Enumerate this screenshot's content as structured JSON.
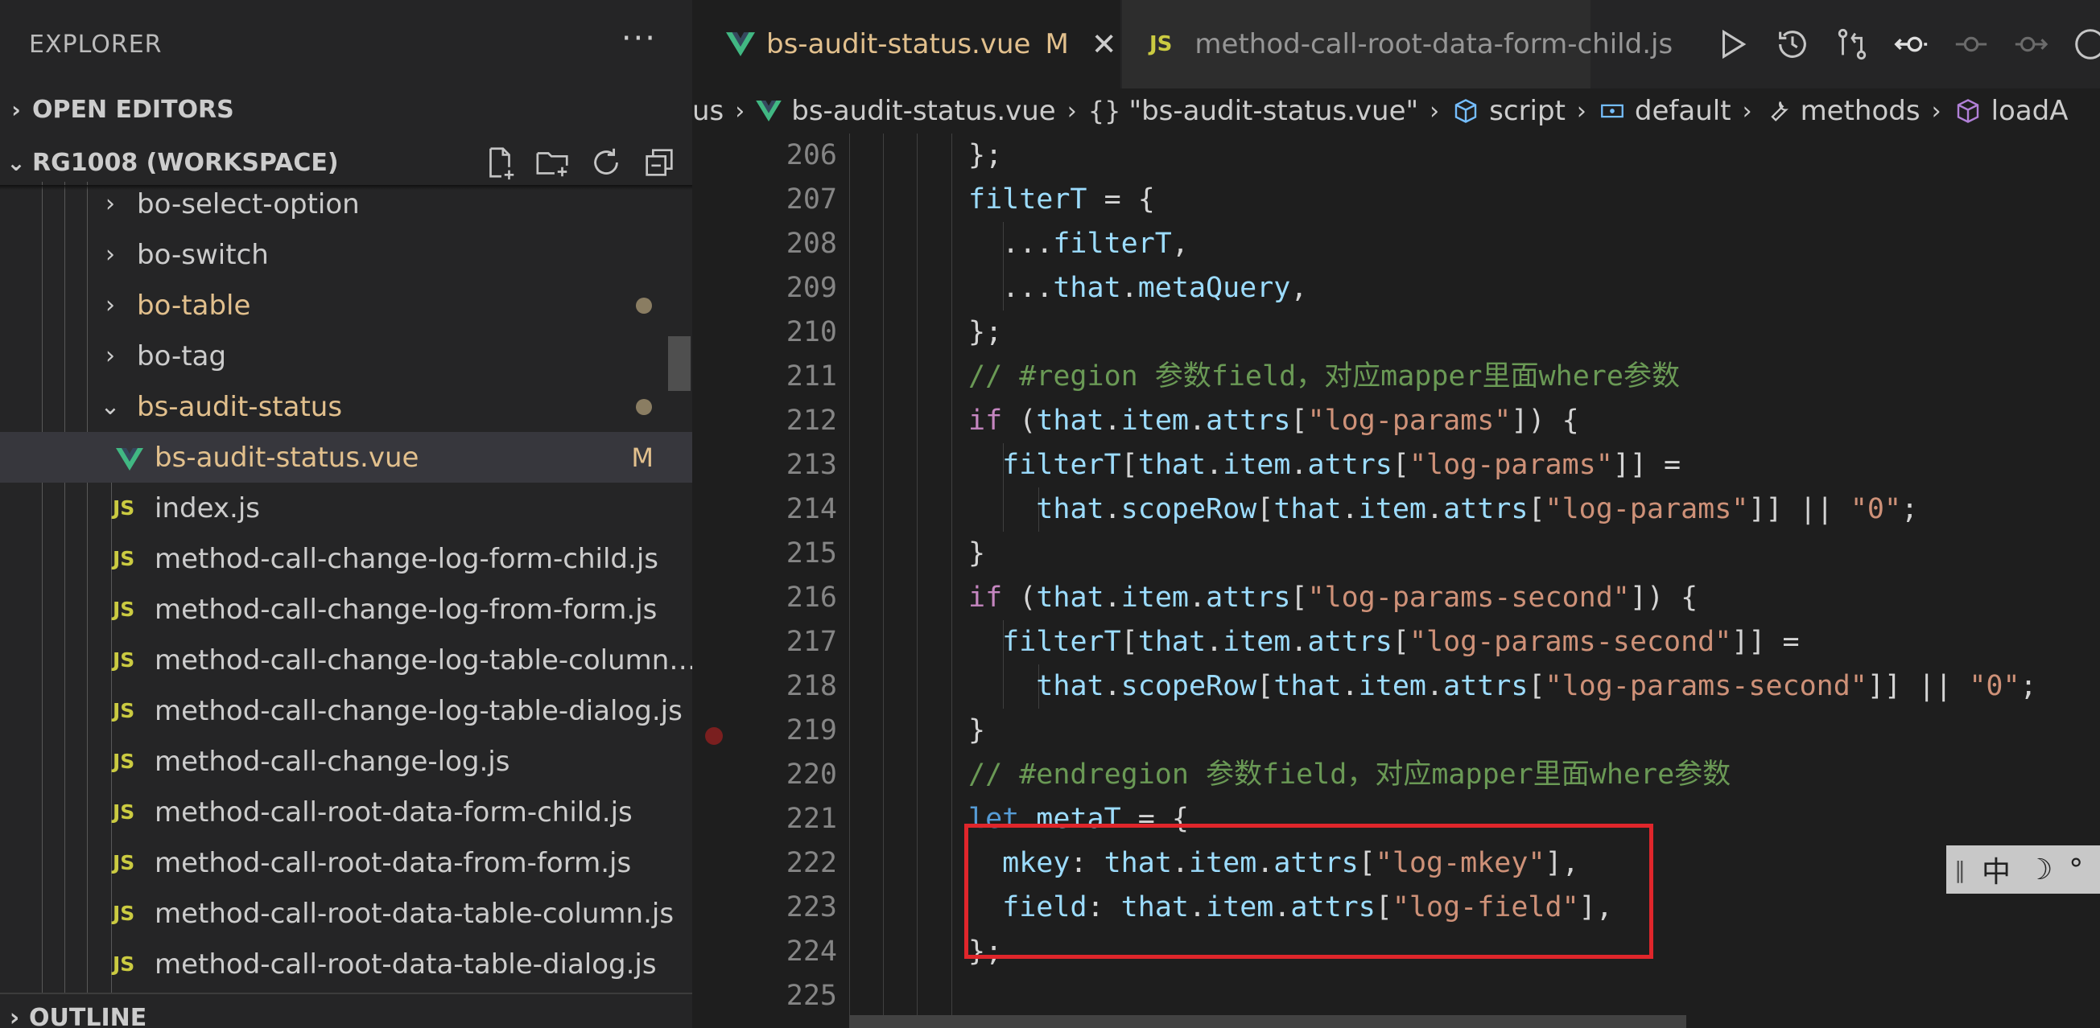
{
  "explorer": {
    "title": "EXPLORER",
    "more_label": "···",
    "open_editors": "OPEN EDITORS",
    "workspace": "RG1008 (WORKSPACE)",
    "outline": "OUTLINE",
    "tree": [
      {
        "label": "bo-select-option",
        "kind": "folder",
        "modified": false
      },
      {
        "label": "bo-switch",
        "kind": "folder",
        "modified": false
      },
      {
        "label": "bo-table",
        "kind": "folder",
        "modified": true
      },
      {
        "label": "bo-tag",
        "kind": "folder",
        "modified": false
      },
      {
        "label": "bs-audit-status",
        "kind": "folder-open",
        "modified": true
      },
      {
        "label": "bs-audit-status.vue",
        "kind": "vue",
        "modified": true,
        "badge": "M",
        "selected": true
      },
      {
        "label": "index.js",
        "kind": "js",
        "icon_text": "JS"
      },
      {
        "label": "method-call-change-log-form-child.js",
        "kind": "js",
        "icon_text": "JS"
      },
      {
        "label": "method-call-change-log-from-form.js",
        "kind": "js",
        "icon_text": "JS"
      },
      {
        "label": "method-call-change-log-table-column…",
        "kind": "js",
        "icon_text": "JS"
      },
      {
        "label": "method-call-change-log-table-dialog.js",
        "kind": "js",
        "icon_text": "JS"
      },
      {
        "label": "method-call-change-log.js",
        "kind": "js",
        "icon_text": "JS"
      },
      {
        "label": "method-call-root-data-form-child.js",
        "kind": "js",
        "icon_text": "JS"
      },
      {
        "label": "method-call-root-data-from-form.js",
        "kind": "js",
        "icon_text": "JS"
      },
      {
        "label": "method-call-root-data-table-column.js",
        "kind": "js",
        "icon_text": "JS"
      },
      {
        "label": "method-call-root-data-table-dialog.js",
        "kind": "js",
        "icon_text": "JS"
      }
    ]
  },
  "tabs": [
    {
      "label": "bs-audit-status.vue",
      "badge": "M",
      "close": "✕",
      "active": true
    },
    {
      "label": "method-call-root-data-form-child.js",
      "icon_text": "JS",
      "active": false
    }
  ],
  "breadcrumb": {
    "part0": "us",
    "file": "bs-audit-status.vue",
    "obj": "\"bs-audit-status.vue\"",
    "obj_icon": "{}",
    "script": "script",
    "default": "default",
    "methods": "methods",
    "last": "loadA"
  },
  "editor": {
    "line_numbers": [
      "206",
      "207",
      "208",
      "209",
      "210",
      "211",
      "212",
      "213",
      "214",
      "215",
      "216",
      "217",
      "218",
      "219",
      "220",
      "221",
      "222",
      "223",
      "224",
      "225"
    ],
    "breakpoint_line": "219"
  },
  "ime": {
    "lang": "中",
    "moon": "☽",
    "deg": "°"
  },
  "colors": {
    "accent_modified": "#e2c08d",
    "highlight_box": "#e0262b",
    "js_icon": "#cbcb41",
    "vue_icon": "#41b883"
  }
}
